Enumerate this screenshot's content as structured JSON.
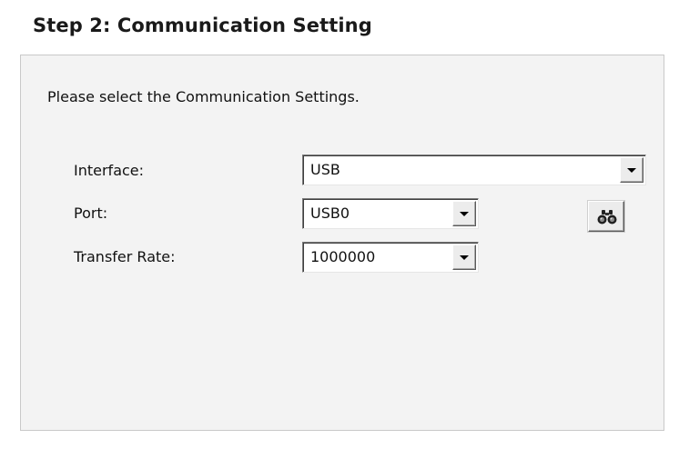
{
  "step": {
    "title": "Step 2: Communication Setting"
  },
  "panel": {
    "instruction": "Please select the Communication Settings."
  },
  "fields": {
    "interface": {
      "label": "Interface:",
      "value": "USB",
      "icon": "chevron-down-icon"
    },
    "port": {
      "label": "Port:",
      "value": "USB0",
      "icon": "chevron-down-icon"
    },
    "transfer_rate": {
      "label": "Transfer Rate:",
      "value": "1000000",
      "icon": "chevron-down-icon"
    }
  },
  "search_button": {
    "icon": "binoculars-icon"
  }
}
